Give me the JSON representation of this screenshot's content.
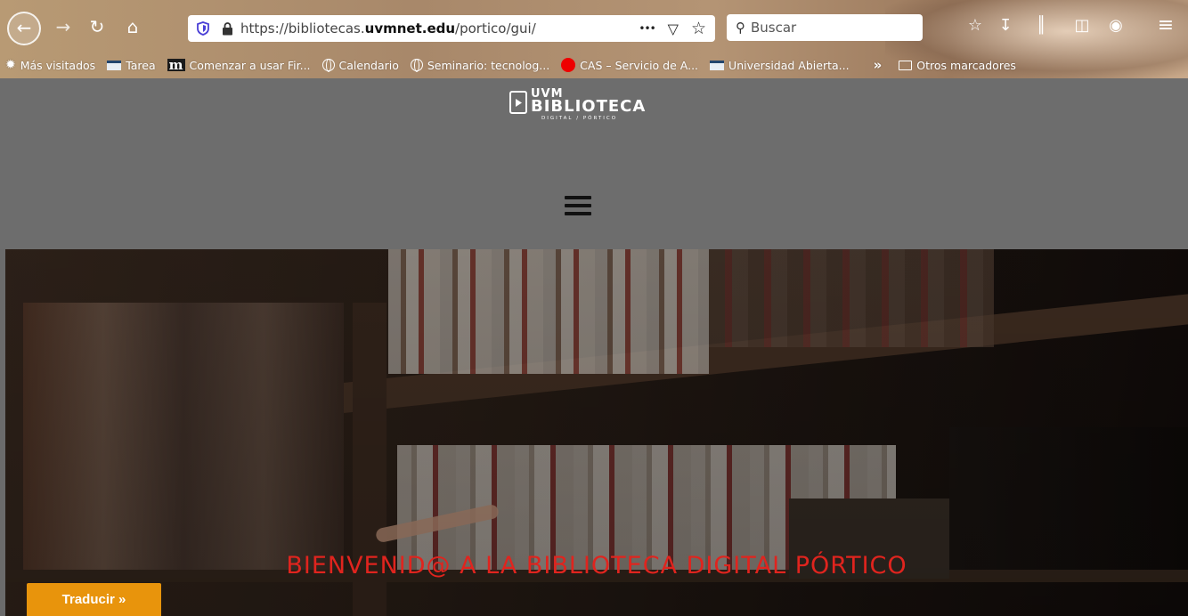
{
  "browser": {
    "url": {
      "scheme": "https://",
      "subdomain": "bibliotecas.",
      "domain": "uvmnet.edu",
      "path": "/portico/gui/"
    },
    "url_actions": {
      "more": "•••",
      "pocket": "▽",
      "bookmark": "☆"
    },
    "search_placeholder": "Buscar",
    "nav_icons": {
      "back": "←",
      "forward": "→",
      "reload": "↻",
      "home": "⌂"
    },
    "tool_icons": {
      "overflow": "»",
      "menu": "≡"
    },
    "bookmarks": [
      {
        "label": "Más visitados",
        "icon": "gear-star-icon"
      },
      {
        "label": "Tarea",
        "icon": "flag-icon"
      },
      {
        "label": "Comenzar a usar Fir...",
        "icon": "m-icon"
      },
      {
        "label": "Calendario",
        "icon": "globe-icon"
      },
      {
        "label": "Seminario: tecnolog...",
        "icon": "globe-icon"
      },
      {
        "label": "CAS – Servicio de A...",
        "icon": "red-dot-icon"
      },
      {
        "label": "Universidad Abierta...",
        "icon": "flag-icon"
      }
    ],
    "bookmarks_overflow": "»",
    "other_bookmarks": "Otros marcadores"
  },
  "site": {
    "logo": {
      "top": "UVM",
      "main": "BIBLIOTECA",
      "sub": "DIGITAL / PÓRTICO"
    },
    "hero_title": "BIENVENID@ A LA BIBLIOTECA DIGITAL PÓRTICO",
    "translate_label": "Traducir »"
  },
  "colors": {
    "header_bg": "#6d6d6d",
    "hero_title": "#e0241e",
    "translate_btn": "#e8940c"
  }
}
